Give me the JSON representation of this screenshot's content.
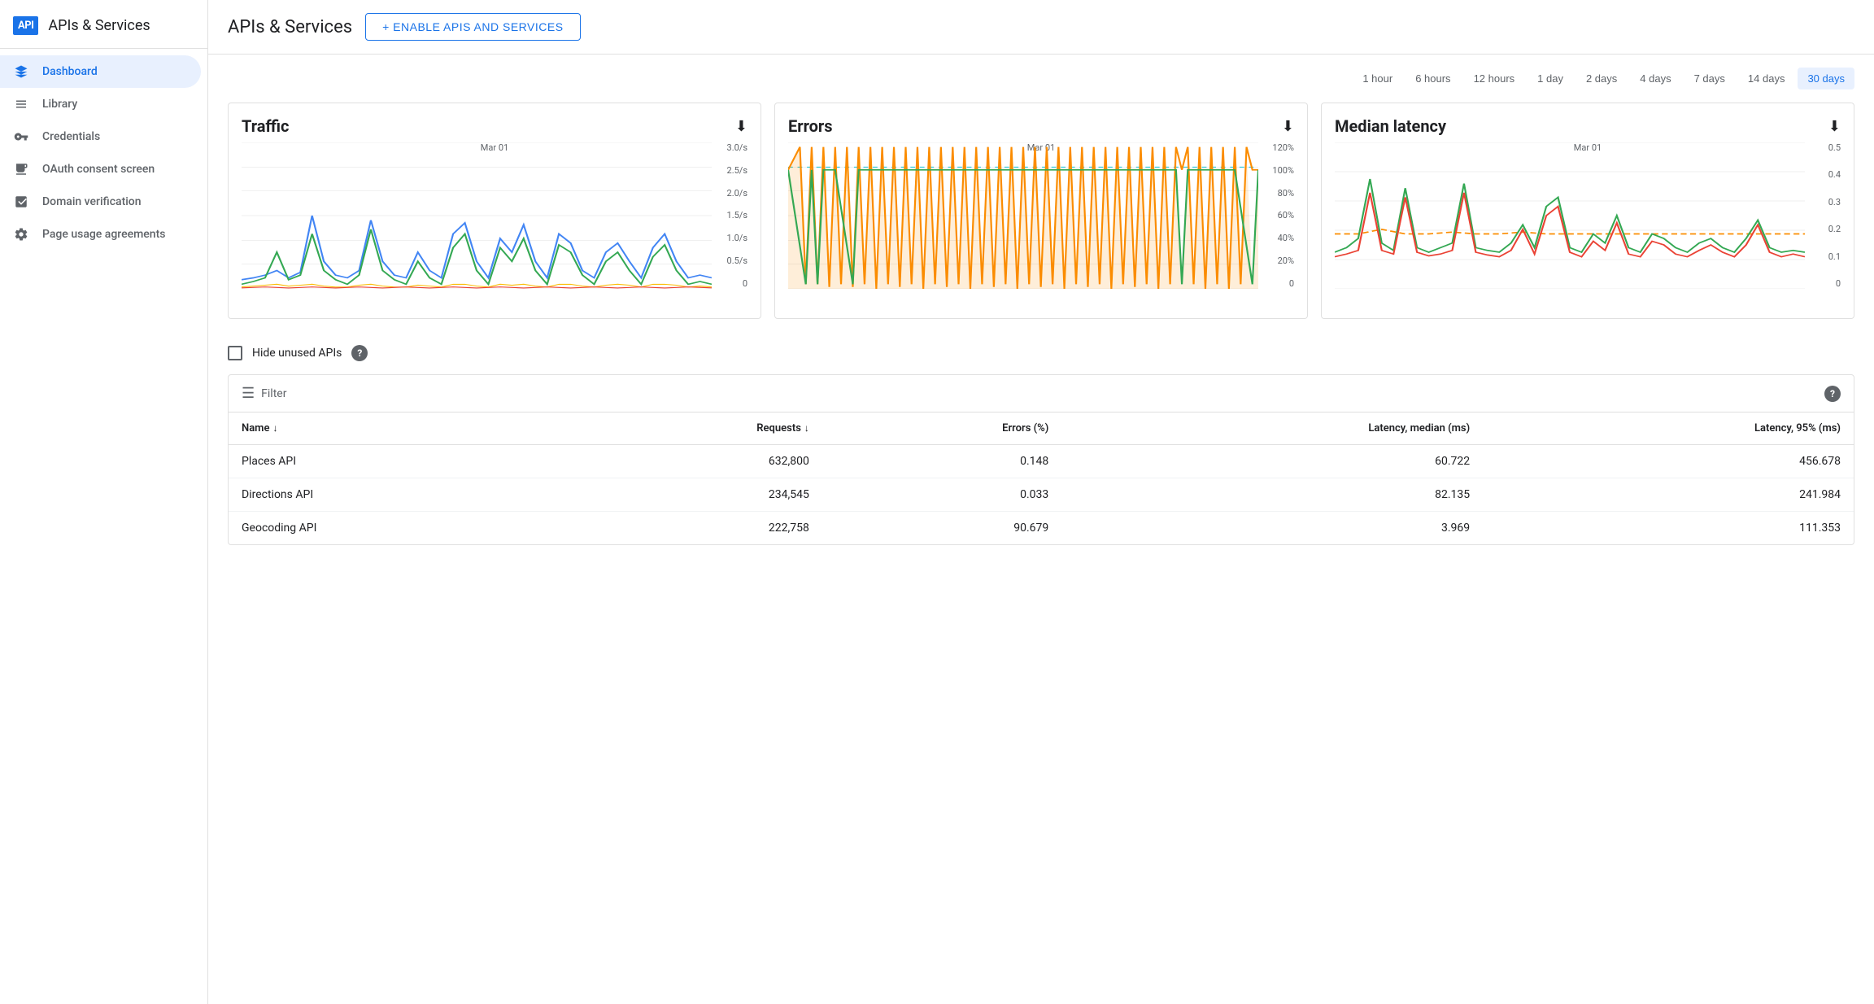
{
  "app": {
    "logo_text": "API",
    "title": "APIs & Services"
  },
  "sidebar": {
    "items": [
      {
        "id": "dashboard",
        "label": "Dashboard",
        "icon": "⬡",
        "active": true
      },
      {
        "id": "library",
        "label": "Library",
        "icon": "≡≡",
        "active": false
      },
      {
        "id": "credentials",
        "label": "Credentials",
        "icon": "⚬—",
        "active": false
      },
      {
        "id": "oauth",
        "label": "OAuth consent screen",
        "icon": "☰",
        "active": false
      },
      {
        "id": "domain",
        "label": "Domain verification",
        "icon": "☑",
        "active": false
      },
      {
        "id": "page-usage",
        "label": "Page usage agreements",
        "icon": "⚙≡",
        "active": false
      }
    ]
  },
  "header": {
    "title": "APIs & Services",
    "enable_button": "+ ENABLE APIS AND SERVICES"
  },
  "time_range": {
    "options": [
      {
        "id": "1h",
        "label": "1 hour"
      },
      {
        "id": "6h",
        "label": "6 hours"
      },
      {
        "id": "12h",
        "label": "12 hours"
      },
      {
        "id": "1d",
        "label": "1 day"
      },
      {
        "id": "2d",
        "label": "2 days"
      },
      {
        "id": "4d",
        "label": "4 days"
      },
      {
        "id": "7d",
        "label": "7 days"
      },
      {
        "id": "14d",
        "label": "14 days"
      },
      {
        "id": "30d",
        "label": "30 days",
        "active": true
      }
    ]
  },
  "charts": {
    "traffic": {
      "title": "Traffic",
      "x_label": "Mar 01",
      "y_labels": [
        "3.0/s",
        "2.5/s",
        "2.0/s",
        "1.5/s",
        "1.0/s",
        "0.5/s",
        "0"
      ]
    },
    "errors": {
      "title": "Errors",
      "x_label": "Mar 01",
      "y_labels": [
        "120%",
        "100%",
        "80%",
        "60%",
        "40%",
        "20%",
        "0"
      ]
    },
    "latency": {
      "title": "Median latency",
      "x_label": "Mar 01",
      "y_labels": [
        "0.5",
        "0.4",
        "0.3",
        "0.2",
        "0.1",
        "0"
      ]
    }
  },
  "hide_unused": {
    "label": "Hide unused APIs",
    "checked": false,
    "help": "?"
  },
  "filter": {
    "label": "Filter"
  },
  "table": {
    "columns": [
      {
        "id": "name",
        "label": "Name",
        "sort": true
      },
      {
        "id": "requests",
        "label": "Requests",
        "sort": true,
        "align": "right"
      },
      {
        "id": "errors",
        "label": "Errors (%)",
        "align": "right"
      },
      {
        "id": "latency_median",
        "label": "Latency, median (ms)",
        "align": "right"
      },
      {
        "id": "latency_95",
        "label": "Latency, 95% (ms)",
        "align": "right"
      }
    ],
    "rows": [
      {
        "name": "Places API",
        "requests": "632,800",
        "errors": "0.148",
        "latency_median": "60.722",
        "latency_95": "456.678"
      },
      {
        "name": "Directions API",
        "requests": "234,545",
        "errors": "0.033",
        "latency_median": "82.135",
        "latency_95": "241.984"
      },
      {
        "name": "Geocoding API",
        "requests": "222,758",
        "errors": "90.679",
        "latency_median": "3.969",
        "latency_95": "111.353"
      }
    ]
  }
}
